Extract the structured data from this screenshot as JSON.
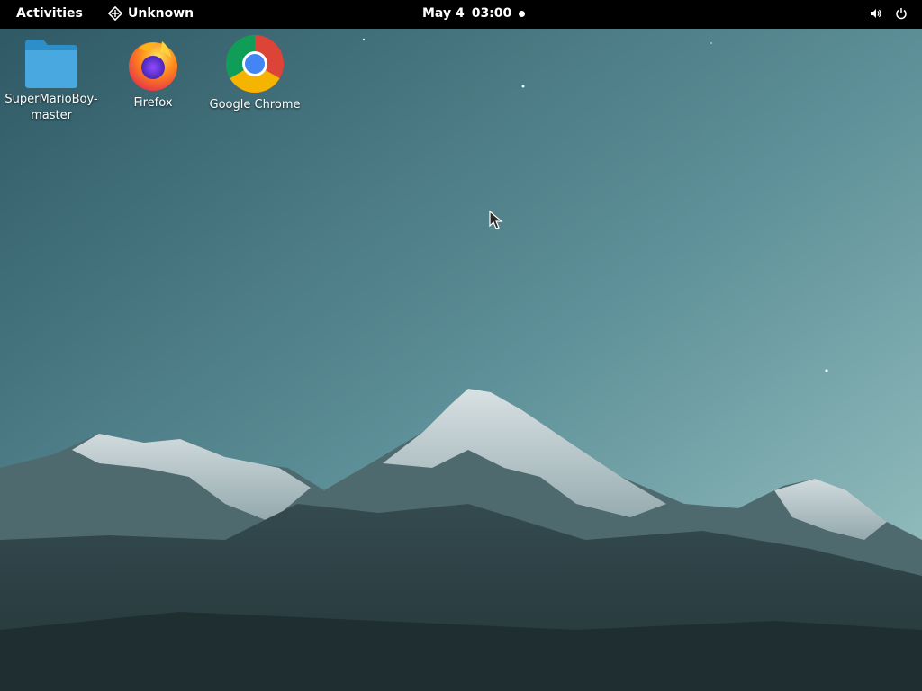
{
  "topbar": {
    "activities_label": "Activities",
    "app_name": "Unknown",
    "date": "May 4",
    "time": "03:00",
    "tray_icons": [
      "volume-icon",
      "power-icon"
    ]
  },
  "desktop": {
    "icons": [
      {
        "label": "SuperMarioBoy-\nmaster",
        "icon": "folder-icon"
      },
      {
        "label": "Firefox",
        "icon": "firefox-icon"
      },
      {
        "label": "Google Chrome",
        "icon": "chrome-icon"
      }
    ]
  },
  "colors": {
    "topbar_bg": "#000000",
    "sky_top": "#2f5a66",
    "sky_bottom": "#8bb8bb",
    "folder": "#3a9fd8"
  }
}
